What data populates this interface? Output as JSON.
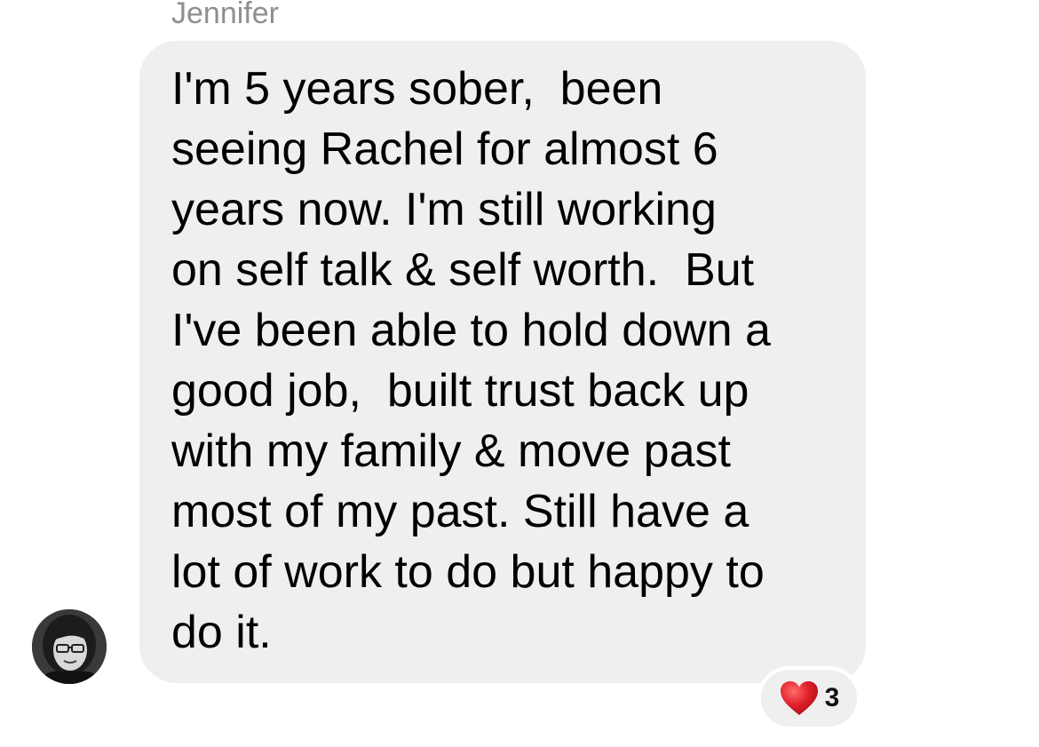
{
  "message": {
    "sender_name": "Jennifer",
    "lines": [
      "I'm 5 years sober,  been",
      "seeing Rachel for almost 6",
      "years now. I'm still working",
      "on self talk & self worth.  But",
      "I've been able to hold down a",
      "good job,  built trust back up",
      "with my family & move past",
      "most of my past. Still have a",
      "lot of work to do but happy to",
      "do it."
    ],
    "avatar_icon": "user-avatar-photo",
    "reaction": {
      "icon": "red-heart-icon",
      "count": "3",
      "color": "#e0202a"
    },
    "bubble_color": "#efefef",
    "name_color": "#8e8e93"
  }
}
